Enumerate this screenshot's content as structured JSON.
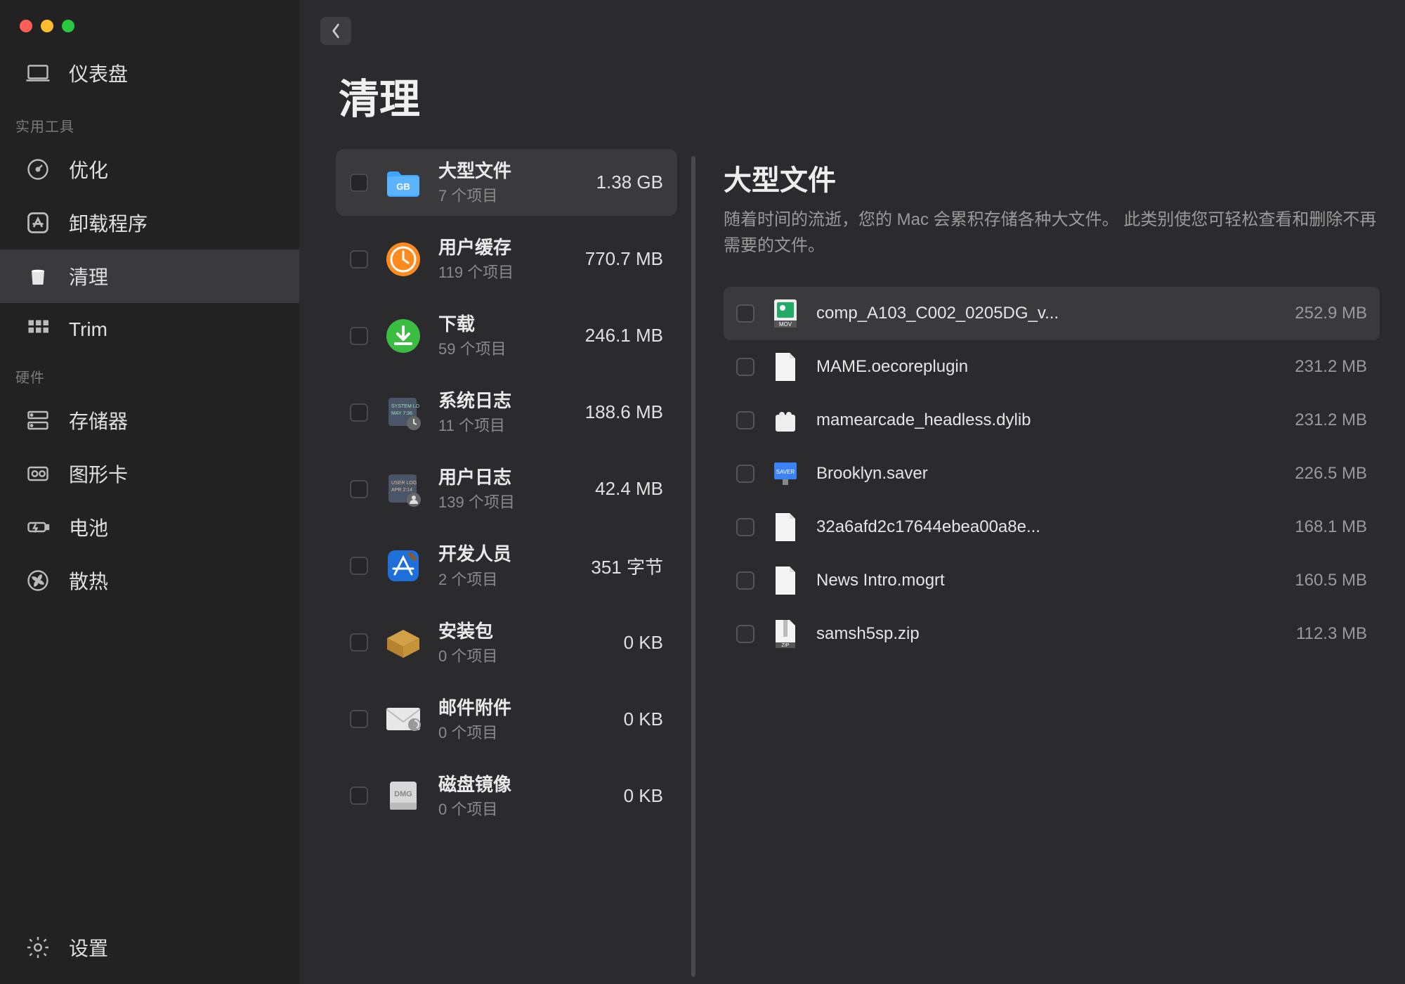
{
  "window": {
    "title": "清理"
  },
  "sidebar": {
    "dashboard": "仪表盘",
    "section_utilities": "实用工具",
    "items_util": [
      {
        "label": "优化",
        "name": "optimize"
      },
      {
        "label": "卸载程序",
        "name": "uninstaller"
      },
      {
        "label": "清理",
        "name": "clean",
        "active": true
      },
      {
        "label": "Trim",
        "name": "trim"
      }
    ],
    "section_hardware": "硬件",
    "items_hw": [
      {
        "label": "存储器",
        "name": "storage"
      },
      {
        "label": "图形卡",
        "name": "graphics"
      },
      {
        "label": "电池",
        "name": "battery"
      },
      {
        "label": "散热",
        "name": "cooling"
      }
    ],
    "settings": "设置"
  },
  "page_title": "清理",
  "categories": [
    {
      "title": "大型文件",
      "subtitle": "7 个项目",
      "size": "1.38 GB",
      "icon": "folder-gb",
      "active": true
    },
    {
      "title": "用户缓存",
      "subtitle": "119 个项目",
      "size": "770.7 MB",
      "icon": "clock-orange"
    },
    {
      "title": "下载",
      "subtitle": "59 个项目",
      "size": "246.1 MB",
      "icon": "download-green"
    },
    {
      "title": "系统日志",
      "subtitle": "11 个项目",
      "size": "188.6 MB",
      "icon": "log-system"
    },
    {
      "title": "用户日志",
      "subtitle": "139 个项目",
      "size": "42.4 MB",
      "icon": "log-user"
    },
    {
      "title": "开发人员",
      "subtitle": "2 个项目",
      "size": "351 字节",
      "icon": "xcode"
    },
    {
      "title": "安装包",
      "subtitle": "0 个项目",
      "size": "0 KB",
      "icon": "package"
    },
    {
      "title": "邮件附件",
      "subtitle": "0 个项目",
      "size": "0 KB",
      "icon": "mail"
    },
    {
      "title": "磁盘镜像",
      "subtitle": "0 个项目",
      "size": "0 KB",
      "icon": "dmg"
    }
  ],
  "detail": {
    "title": "大型文件",
    "description": "随着时间的流逝，您的 Mac 会累积存储各种大文件。 此类别使您可轻松查看和删除不再需要的文件。",
    "files": [
      {
        "name": "comp_A103_C002_0205DG_v...",
        "size": "252.9 MB",
        "icon": "mov",
        "active": true
      },
      {
        "name": "MAME.oecoreplugin",
        "size": "231.2 MB",
        "icon": "doc"
      },
      {
        "name": "mamearcade_headless.dylib",
        "size": "231.2 MB",
        "icon": "lego"
      },
      {
        "name": "Brooklyn.saver",
        "size": "226.5 MB",
        "icon": "saver"
      },
      {
        "name": "32a6afd2c17644ebea00a8e...",
        "size": "168.1 MB",
        "icon": "doc"
      },
      {
        "name": "News Intro.mogrt",
        "size": "160.5 MB",
        "icon": "doc"
      },
      {
        "name": "samsh5sp.zip",
        "size": "112.3 MB",
        "icon": "zip"
      }
    ]
  }
}
